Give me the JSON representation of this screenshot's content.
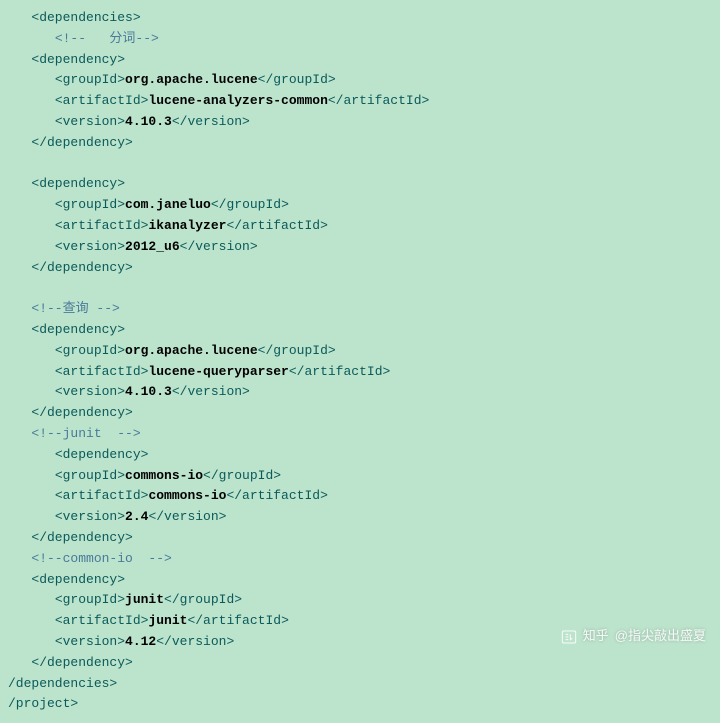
{
  "code": {
    "tag_dependencies_open": "<dependencies>",
    "comment_fenci": "<!--   分词-->",
    "tag_dependency_open": "<dependency>",
    "tag_groupId_open": "<groupId>",
    "tag_groupId_close": "</groupId>",
    "tag_artifactId_open": "<artifactId>",
    "tag_artifactId_close": "</artifactId>",
    "tag_version_open": "<version>",
    "tag_version_close": "</version>",
    "tag_dependency_close": "</dependency>",
    "comment_chaxun": "<!--查询 -->",
    "comment_junit": "<!--junit  -->",
    "comment_commonio": "<!--common-io  -->",
    "tag_dependencies_close": "/dependencies>",
    "tag_project_close": "/project>",
    "dep1_group": "org.apache.lucene",
    "dep1_artifact": "lucene-analyzers-common",
    "dep1_version": "4.10.3",
    "dep2_group": "com.janeluo",
    "dep2_artifact": "ikanalyzer",
    "dep2_version": "2012_u6",
    "dep3_group": "org.apache.lucene",
    "dep3_artifact": "lucene-queryparser",
    "dep3_version": "4.10.3",
    "dep4_group": "commons-io",
    "dep4_artifact": "commons-io",
    "dep4_version": "2.4",
    "dep5_group": "junit",
    "dep5_artifact": "junit",
    "dep5_version": "4.12"
  },
  "watermark": {
    "brand": "知乎",
    "author": "@指尖敲出盛夏"
  }
}
